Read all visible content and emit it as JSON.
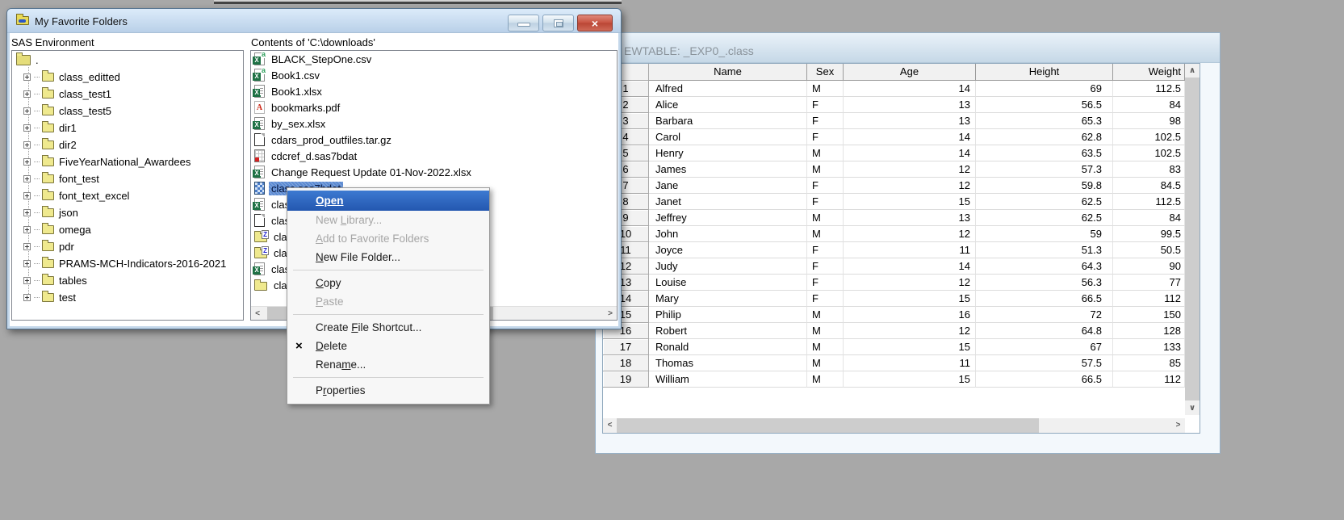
{
  "colors": {
    "desktop_bg": "#a8a8a8",
    "selection_blue": "#5b8ad2",
    "menu_highlight_blue": "#2f6fc9",
    "active_titlebar": "#c9dcee",
    "inactive_titlebar": "#d8e5f0",
    "folder_yellow": "#efe98e",
    "excel_green": "#1e7145",
    "pdf_red": "#cc2211",
    "close_button_red": "#c65140"
  },
  "icons": {
    "scroll_up": "∧",
    "scroll_down": "∨",
    "scroll_left": "<",
    "scroll_right": ">",
    "close_glyph": "×",
    "delete_glyph": "×"
  },
  "favorites_window": {
    "title": "My Favorite Folders",
    "caption_buttons": {
      "minimize": "minimize",
      "maximize": "maximize",
      "close": "close"
    },
    "left_pane": {
      "header": "SAS Environment",
      "root_label": ".",
      "items": [
        {
          "label": "class_editted"
        },
        {
          "label": "class_test1"
        },
        {
          "label": "class_test5"
        },
        {
          "label": "dir1"
        },
        {
          "label": "dir2"
        },
        {
          "label": "FiveYearNational_Awardees"
        },
        {
          "label": "font_test"
        },
        {
          "label": "font_text_excel"
        },
        {
          "label": "json"
        },
        {
          "label": "omega"
        },
        {
          "label": "pdr"
        },
        {
          "label": "PRAMS-MCH-Indicators-2016-2021"
        },
        {
          "label": "tables"
        },
        {
          "label": "test"
        }
      ]
    },
    "right_pane": {
      "header": "Contents of 'C:\\downloads'",
      "files": [
        {
          "name": "BLACK_StepOne.csv",
          "icon": "excel-csv"
        },
        {
          "name": "Book1.csv",
          "icon": "excel-csv"
        },
        {
          "name": "Book1.xlsx",
          "icon": "excel-xlsx"
        },
        {
          "name": "bookmarks.pdf",
          "icon": "pdf"
        },
        {
          "name": "by_sex.xlsx",
          "icon": "excel-xlsx"
        },
        {
          "name": "cdars_prod_outfiles.tar.gz",
          "icon": "file"
        },
        {
          "name": "cdcref_d.sas7bdat",
          "icon": "sas-dataset"
        },
        {
          "name": "Change Request Update 01-Nov-2022.xlsx",
          "icon": "excel-xlsx"
        },
        {
          "name": "class.sas7bdat",
          "icon": "sas-table",
          "selected": true
        },
        {
          "name": "class",
          "icon": "excel-xlsx"
        },
        {
          "name": "class",
          "icon": "file"
        },
        {
          "name": "class",
          "icon": "zip-folder"
        },
        {
          "name": "class",
          "icon": "zip-folder"
        },
        {
          "name": "class",
          "icon": "excel-xlsx"
        },
        {
          "name": "class",
          "icon": "folder"
        }
      ]
    }
  },
  "context_menu": {
    "items": [
      {
        "pre": "",
        "u": "Open",
        "post": "",
        "state": "highlighted"
      },
      {
        "pre": "New ",
        "u": "L",
        "post": "ibrary...",
        "state": "disabled"
      },
      {
        "pre": "",
        "u": "A",
        "post": "dd to Favorite Folders",
        "state": "disabled"
      },
      {
        "pre": "",
        "u": "N",
        "post": "ew File Folder...",
        "state": "normal"
      },
      {
        "type": "separator"
      },
      {
        "pre": "",
        "u": "C",
        "post": "opy",
        "state": "normal"
      },
      {
        "pre": "",
        "u": "P",
        "post": "aste",
        "state": "disabled"
      },
      {
        "type": "separator"
      },
      {
        "pre": "Create ",
        "u": "F",
        "post": "ile Shortcut...",
        "state": "normal"
      },
      {
        "pre": "",
        "u": "D",
        "post": "elete",
        "state": "normal",
        "icon": "delete-x"
      },
      {
        "pre": "Rena",
        "u": "m",
        "post": "e...",
        "state": "normal"
      },
      {
        "type": "separator"
      },
      {
        "pre": "P",
        "u": "r",
        "post": "operties",
        "state": "normal"
      }
    ]
  },
  "viewtable_window": {
    "title_visible": "EWTABLE: _EXP0_.class",
    "columns": [
      "Name",
      "Sex",
      "Age",
      "Height",
      "Weight"
    ],
    "rows": [
      [
        1,
        "Alfred",
        "M",
        14,
        69,
        112.5
      ],
      [
        2,
        "Alice",
        "F",
        13,
        56.5,
        84
      ],
      [
        3,
        "Barbara",
        "F",
        13,
        65.3,
        98
      ],
      [
        4,
        "Carol",
        "F",
        14,
        62.8,
        102.5
      ],
      [
        5,
        "Henry",
        "M",
        14,
        63.5,
        102.5
      ],
      [
        6,
        "James",
        "M",
        12,
        57.3,
        83
      ],
      [
        7,
        "Jane",
        "F",
        12,
        59.8,
        84.5
      ],
      [
        8,
        "Janet",
        "F",
        15,
        62.5,
        112.5
      ],
      [
        9,
        "Jeffrey",
        "M",
        13,
        62.5,
        84
      ],
      [
        10,
        "John",
        "M",
        12,
        59,
        99.5
      ],
      [
        11,
        "Joyce",
        "F",
        11,
        51.3,
        50.5
      ],
      [
        12,
        "Judy",
        "F",
        14,
        64.3,
        90
      ],
      [
        13,
        "Louise",
        "F",
        12,
        56.3,
        77
      ],
      [
        14,
        "Mary",
        "F",
        15,
        66.5,
        112
      ],
      [
        15,
        "Philip",
        "M",
        16,
        72,
        150
      ],
      [
        16,
        "Robert",
        "M",
        12,
        64.8,
        128
      ],
      [
        17,
        "Ronald",
        "M",
        15,
        67,
        133
      ],
      [
        18,
        "Thomas",
        "M",
        11,
        57.5,
        85
      ],
      [
        19,
        "William",
        "M",
        15,
        66.5,
        112
      ]
    ]
  }
}
